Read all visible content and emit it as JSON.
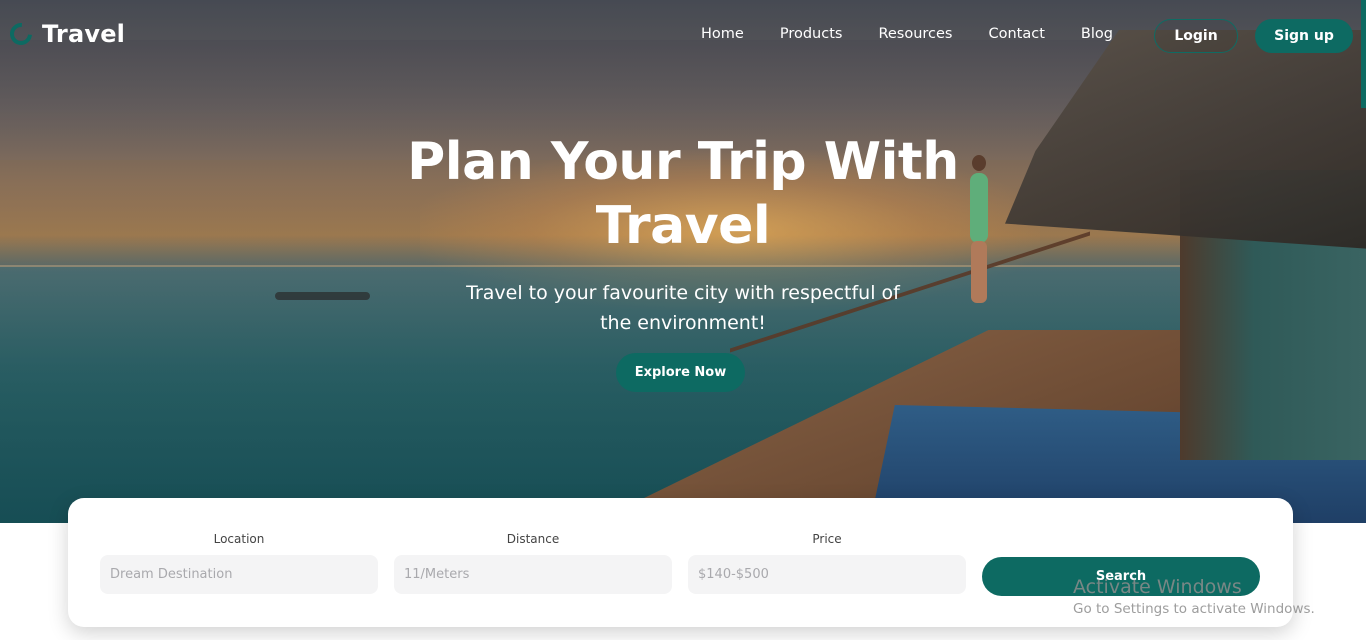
{
  "nav": {
    "brand": "Travel",
    "links": [
      "Home",
      "Products",
      "Resources",
      "Contact",
      "Blog"
    ],
    "login_label": "Login",
    "signup_label": "Sign up"
  },
  "hero": {
    "title_line1": "Plan Your Trip With",
    "title_line2": "Travel",
    "subtitle_line1": "Travel to your favourite city with respectful of",
    "subtitle_line2": "the environment!",
    "cta_label": "Explore Now"
  },
  "search": {
    "fields": [
      {
        "label": "Location",
        "placeholder": "Dream Destination"
      },
      {
        "label": "Distance",
        "placeholder": "11/Meters"
      },
      {
        "label": "Price",
        "placeholder": "$140-$500"
      }
    ],
    "button_label": "Search"
  },
  "watermark": {
    "line1": "Activate Windows",
    "line2": "Go to Settings to activate Windows."
  },
  "colors": {
    "accent": "#0d6a62",
    "text_light": "#ffffff",
    "card_bg": "#ffffff",
    "input_bg": "#f4f4f5"
  },
  "icons": {
    "brand": "brand-logo-icon"
  }
}
